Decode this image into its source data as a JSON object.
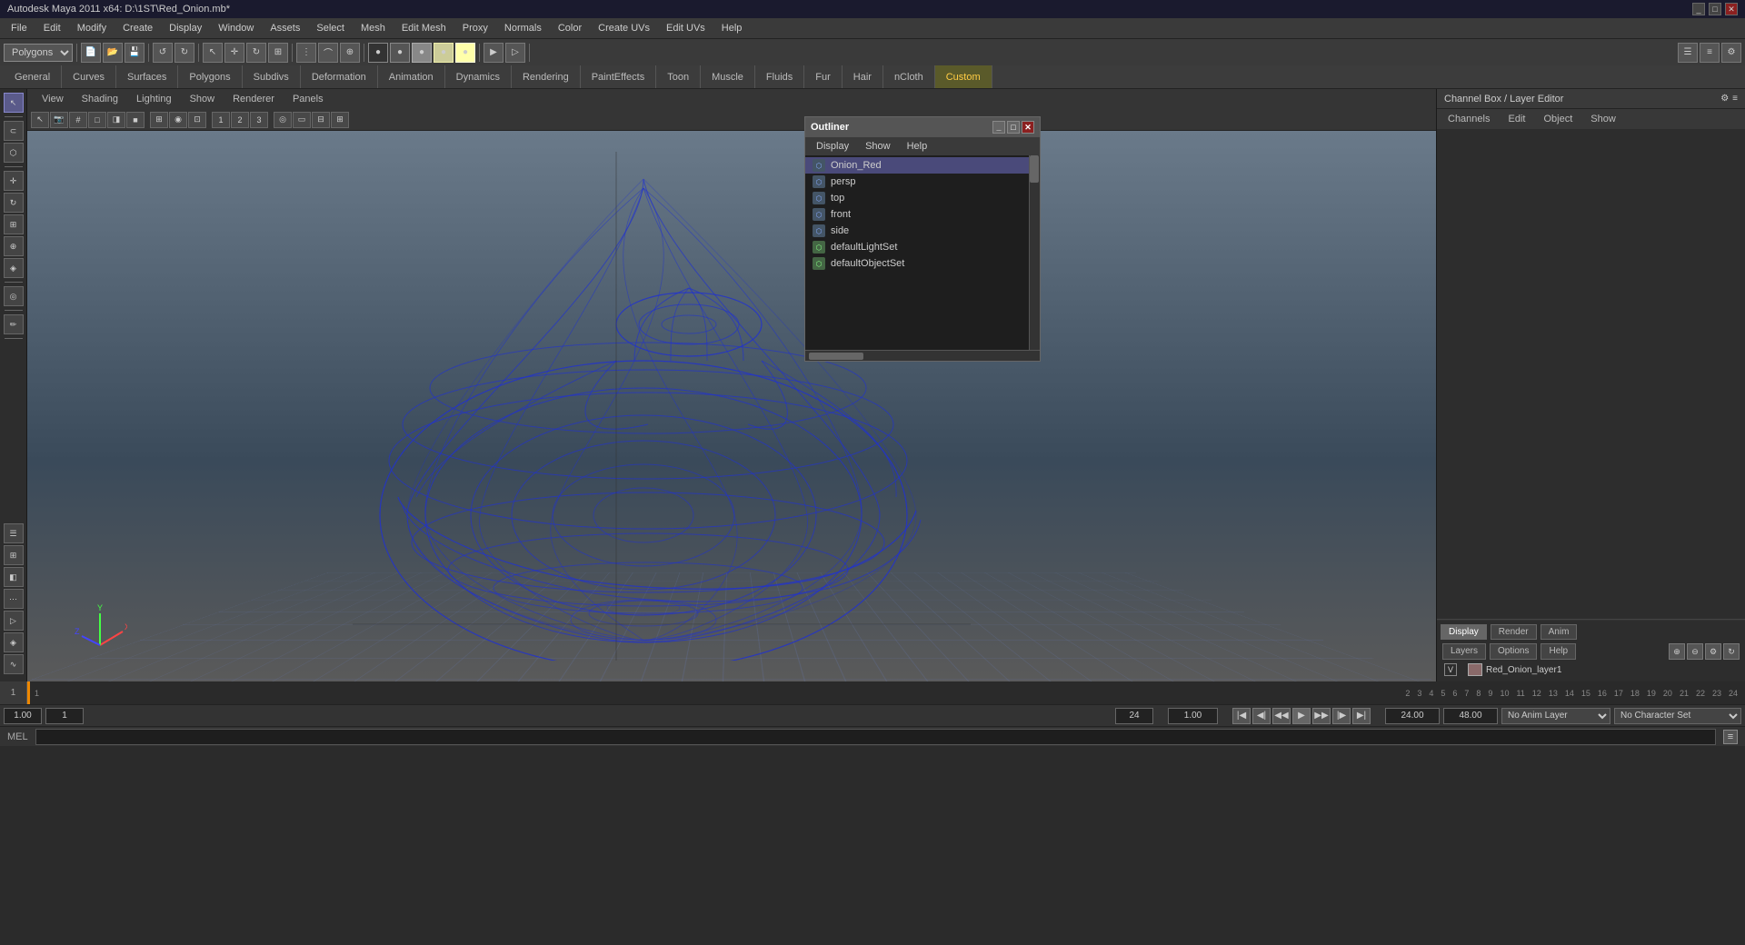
{
  "titlebar": {
    "title": "Autodesk Maya 2011 x64: D:\\1ST\\Red_Onion.mb*",
    "controls": [
      "_",
      "□",
      "✕"
    ]
  },
  "menubar": {
    "items": [
      "File",
      "Edit",
      "Modify",
      "Create",
      "Display",
      "Window",
      "Assets",
      "Select",
      "Mesh",
      "Edit Mesh",
      "Proxy",
      "Normals",
      "Color",
      "Create UVs",
      "Edit UVs",
      "Help"
    ]
  },
  "toolbar_dropdown": "Polygons",
  "tabs": {
    "items": [
      "General",
      "Curves",
      "Surfaces",
      "Polygons",
      "Subdivs",
      "Deformation",
      "Animation",
      "Dynamics",
      "Rendering",
      "PaintEffects",
      "Toon",
      "Muscle",
      "Fluids",
      "Fur",
      "Hair",
      "nCloth",
      "Custom"
    ]
  },
  "viewport_menu": {
    "items": [
      "View",
      "Shading",
      "Lighting",
      "Show",
      "Renderer",
      "Panels"
    ]
  },
  "outliner": {
    "title": "Outliner",
    "menu": [
      "Display",
      "Show",
      "Help"
    ],
    "items": [
      {
        "name": "Onion_Red",
        "type": "mesh",
        "icon": "⬡"
      },
      {
        "name": "persp",
        "type": "camera",
        "icon": "⬡"
      },
      {
        "name": "top",
        "type": "camera",
        "icon": "⬡"
      },
      {
        "name": "front",
        "type": "camera",
        "icon": "⬡"
      },
      {
        "name": "side",
        "type": "camera",
        "icon": "⬡"
      },
      {
        "name": "defaultLightSet",
        "type": "set",
        "icon": "⬡"
      },
      {
        "name": "defaultObjectSet",
        "type": "set",
        "icon": "⬡"
      }
    ]
  },
  "channel_box": {
    "header": "Channel Box / Layer Editor",
    "tabs": [
      "Channels",
      "Edit",
      "Object",
      "Show"
    ]
  },
  "layer_editor": {
    "tabs": [
      "Display",
      "Render",
      "Anim"
    ],
    "sub_tabs": [
      "Layers",
      "Options",
      "Help"
    ],
    "layer_name": "Red_Onion_layer1",
    "v_label": "V"
  },
  "timeline": {
    "start": "1",
    "end": "24",
    "current": "1",
    "ticks": [
      "1",
      "2",
      "3",
      "4",
      "5",
      "6",
      "7",
      "8",
      "9",
      "10",
      "11",
      "12",
      "13",
      "14",
      "15",
      "16",
      "17",
      "18",
      "19",
      "20",
      "21",
      "22",
      "23",
      "24"
    ]
  },
  "playback": {
    "start_time": "1.00",
    "end_time": "24.00",
    "current_time": "1.00",
    "range_start": "1.00",
    "range_end": "24.00",
    "anim_layer": "No Anim Layer",
    "character_set": "No Character Set",
    "frame_input": "1.00"
  },
  "statusbar": {
    "mel_label": "MEL"
  },
  "axis": {
    "x": "X",
    "y": "Y",
    "z": "Z"
  }
}
